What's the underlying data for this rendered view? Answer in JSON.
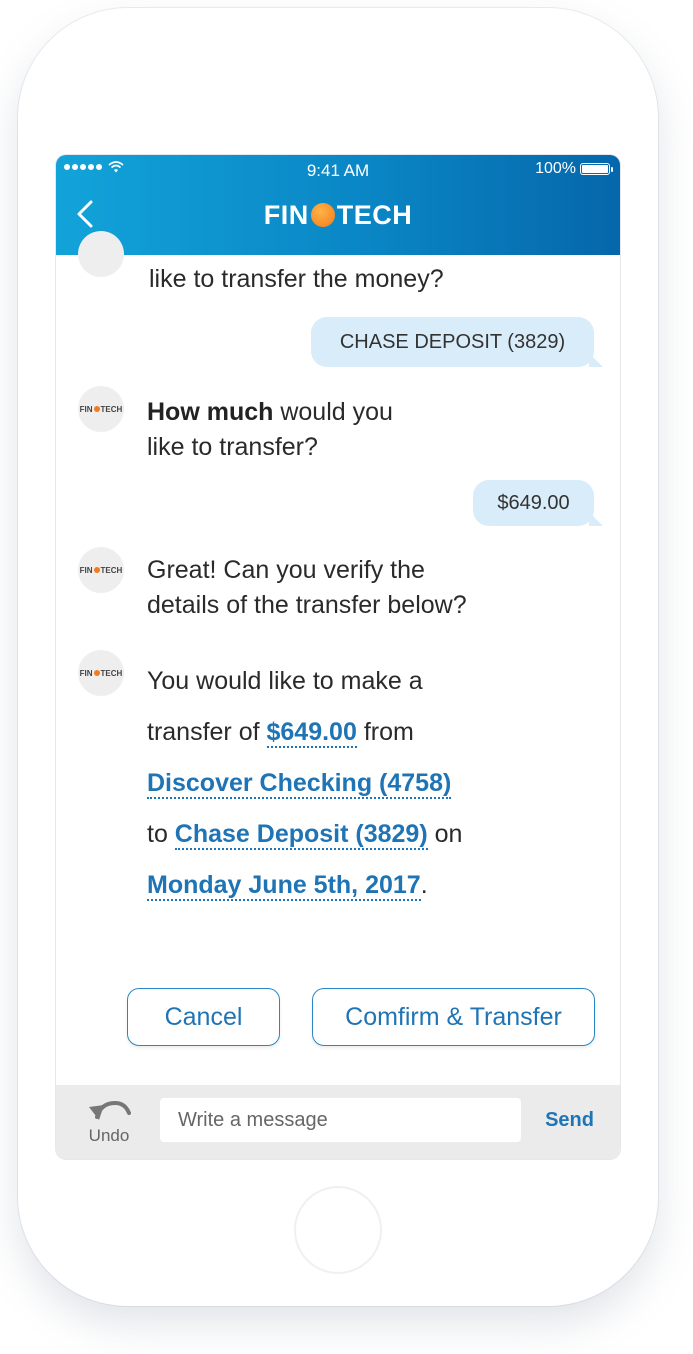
{
  "status_bar": {
    "time": "9:41 AM",
    "battery": "100%"
  },
  "header": {
    "logo_left": "FIN",
    "logo_right": "TECH"
  },
  "avatar_label": {
    "left": "FIN",
    "right": "TECH"
  },
  "messages": {
    "partial": "like to transfer the money?",
    "user_account": "CHASE DEPOSIT (3829)",
    "how_much_bold": "How much",
    "how_much_rest": " would you",
    "how_much_line2": "like to transfer?",
    "user_amount": "$649.00",
    "verify_line1": "Great! Can you verify the",
    "verify_line2": "details of the transfer below?"
  },
  "details": {
    "line1": "You would like to make a",
    "transfer_of": "transfer of ",
    "amount": "$649.00",
    "from": " from",
    "from_account": "Discover Checking (4758)",
    "to": "to ",
    "to_account": "Chase Deposit (3829)",
    "on": " on",
    "date": "Monday June 5th, 2017",
    "period": "."
  },
  "actions": {
    "cancel": "Cancel",
    "confirm": "Comfirm & Transfer"
  },
  "composer": {
    "undo": "Undo",
    "placeholder": "Write a message",
    "send": "Send"
  },
  "colors": {
    "header_start": "#12a3d9",
    "header_end": "#0567ab",
    "accent": "#1e74b5",
    "bubble": "#d9ecfa",
    "logo_dot": "#f47a1b"
  },
  "icons": [
    "back-chevron-icon",
    "wifi-icon",
    "signal-icon",
    "battery-icon",
    "undo-icon"
  ]
}
